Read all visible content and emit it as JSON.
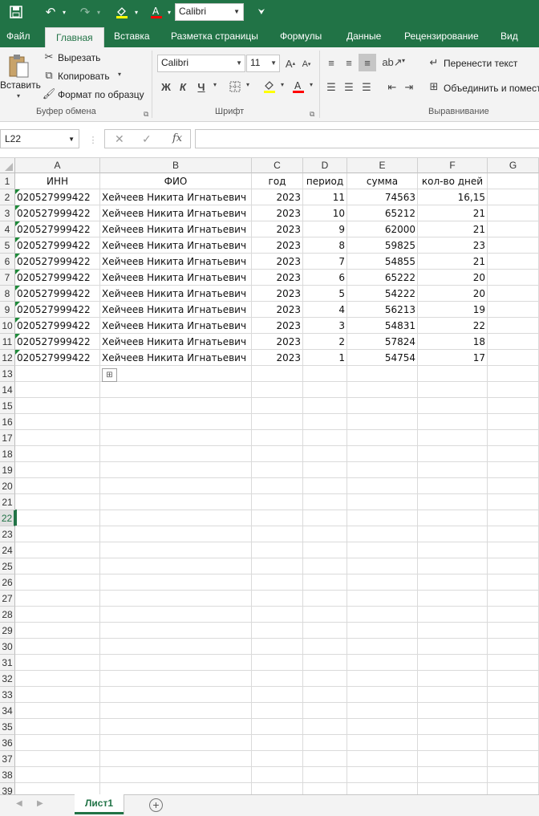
{
  "qat": {
    "font_value": "Calibri",
    "icons": [
      "save-icon",
      "undo-icon",
      "redo-icon",
      "fill-color-icon",
      "font-color-icon",
      "customize-qat-icon"
    ],
    "colors": {
      "brand": "#217346"
    }
  },
  "tabs": [
    "Файл",
    "Главная",
    "Вставка",
    "Разметка страницы",
    "Формулы",
    "Данные",
    "Рецензирование",
    "Вид"
  ],
  "ribbon": {
    "clipboard": {
      "paste": "Вставить",
      "cut": "Вырезать",
      "copy": "Копировать",
      "format_painter": "Формат по образцу",
      "label": "Буфер обмена"
    },
    "font": {
      "font_name": "Calibri",
      "font_size": "11",
      "bold": "Ж",
      "italic": "К",
      "underline": "Ч",
      "label": "Шрифт"
    },
    "alignment": {
      "wrap_text": "Перенести текст",
      "merge": "Объединить и помест",
      "label": "Выравнивание"
    }
  },
  "formula_bar": {
    "name_box": "L22",
    "fx": "fx",
    "value": ""
  },
  "grid": {
    "columns": [
      {
        "letter": "A"
      },
      {
        "letter": "B"
      },
      {
        "letter": "C"
      },
      {
        "letter": "D"
      },
      {
        "letter": "E"
      },
      {
        "letter": "F"
      },
      {
        "letter": "G"
      }
    ],
    "headers": [
      "ИНН",
      "ФИО",
      "год",
      "период",
      "сумма",
      "кол-во дней"
    ],
    "rows": [
      [
        "020527999422",
        "Хейчеев Никита Игнатьевич",
        "2023",
        "11",
        "74563",
        "16,15"
      ],
      [
        "020527999422",
        "Хейчеев Никита Игнатьевич",
        "2023",
        "10",
        "65212",
        "21"
      ],
      [
        "020527999422",
        "Хейчеев Никита Игнатьевич",
        "2023",
        "9",
        "62000",
        "21"
      ],
      [
        "020527999422",
        "Хейчеев Никита Игнатьевич",
        "2023",
        "8",
        "59825",
        "23"
      ],
      [
        "020527999422",
        "Хейчеев Никита Игнатьевич",
        "2023",
        "7",
        "54855",
        "21"
      ],
      [
        "020527999422",
        "Хейчеев Никита Игнатьевич",
        "2023",
        "6",
        "65222",
        "20"
      ],
      [
        "020527999422",
        "Хейчеев Никита Игнатьевич",
        "2023",
        "5",
        "54222",
        "20"
      ],
      [
        "020527999422",
        "Хейчеев Никита Игнатьевич",
        "2023",
        "4",
        "56213",
        "19"
      ],
      [
        "020527999422",
        "Хейчеев Никита Игнатьевич",
        "2023",
        "3",
        "54831",
        "22"
      ],
      [
        "020527999422",
        "Хейчеев Никита Игнатьевич",
        "2023",
        "2",
        "57824",
        "18"
      ],
      [
        "020527999422",
        "Хейчеев Никита Игнатьевич",
        "2023",
        "1",
        "54754",
        "17"
      ]
    ],
    "row_numbers": [
      "1",
      "2",
      "3",
      "4",
      "5",
      "6",
      "7",
      "8",
      "9",
      "10",
      "11",
      "12",
      "13",
      "14",
      "15",
      "16",
      "17",
      "18",
      "19",
      "20",
      "21",
      "22",
      "23",
      "24",
      "25",
      "26",
      "27",
      "28",
      "29",
      "30",
      "31",
      "32",
      "33",
      "34",
      "35",
      "36",
      "37",
      "38",
      "39"
    ],
    "selected_row": "22"
  },
  "sheets": {
    "active": "Лист1",
    "add_icon": "plus-circle-icon"
  }
}
